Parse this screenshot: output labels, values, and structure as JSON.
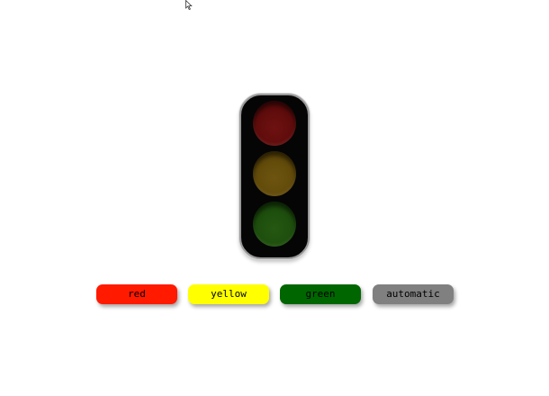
{
  "traffic_light": {
    "lamps": {
      "red": {
        "color": "#5a0a0a",
        "glow": "#6e1111",
        "state": "off"
      },
      "yellow": {
        "color": "#5e4708",
        "glow": "#6d5410",
        "state": "off"
      },
      "green": {
        "color": "#1b4a0b",
        "glow": "#255812",
        "state": "off"
      }
    },
    "housing_color": "#050505",
    "border_color": "#9a9a9a"
  },
  "controls": {
    "red": {
      "label": "red",
      "color": "#ff1a00"
    },
    "yellow": {
      "label": "yellow",
      "color": "#ffff00"
    },
    "green": {
      "label": "green",
      "color": "#006600"
    },
    "automatic": {
      "label": "automatic",
      "color": "#808080"
    }
  },
  "cursor": {
    "icon": "pointer-arrow-icon"
  }
}
